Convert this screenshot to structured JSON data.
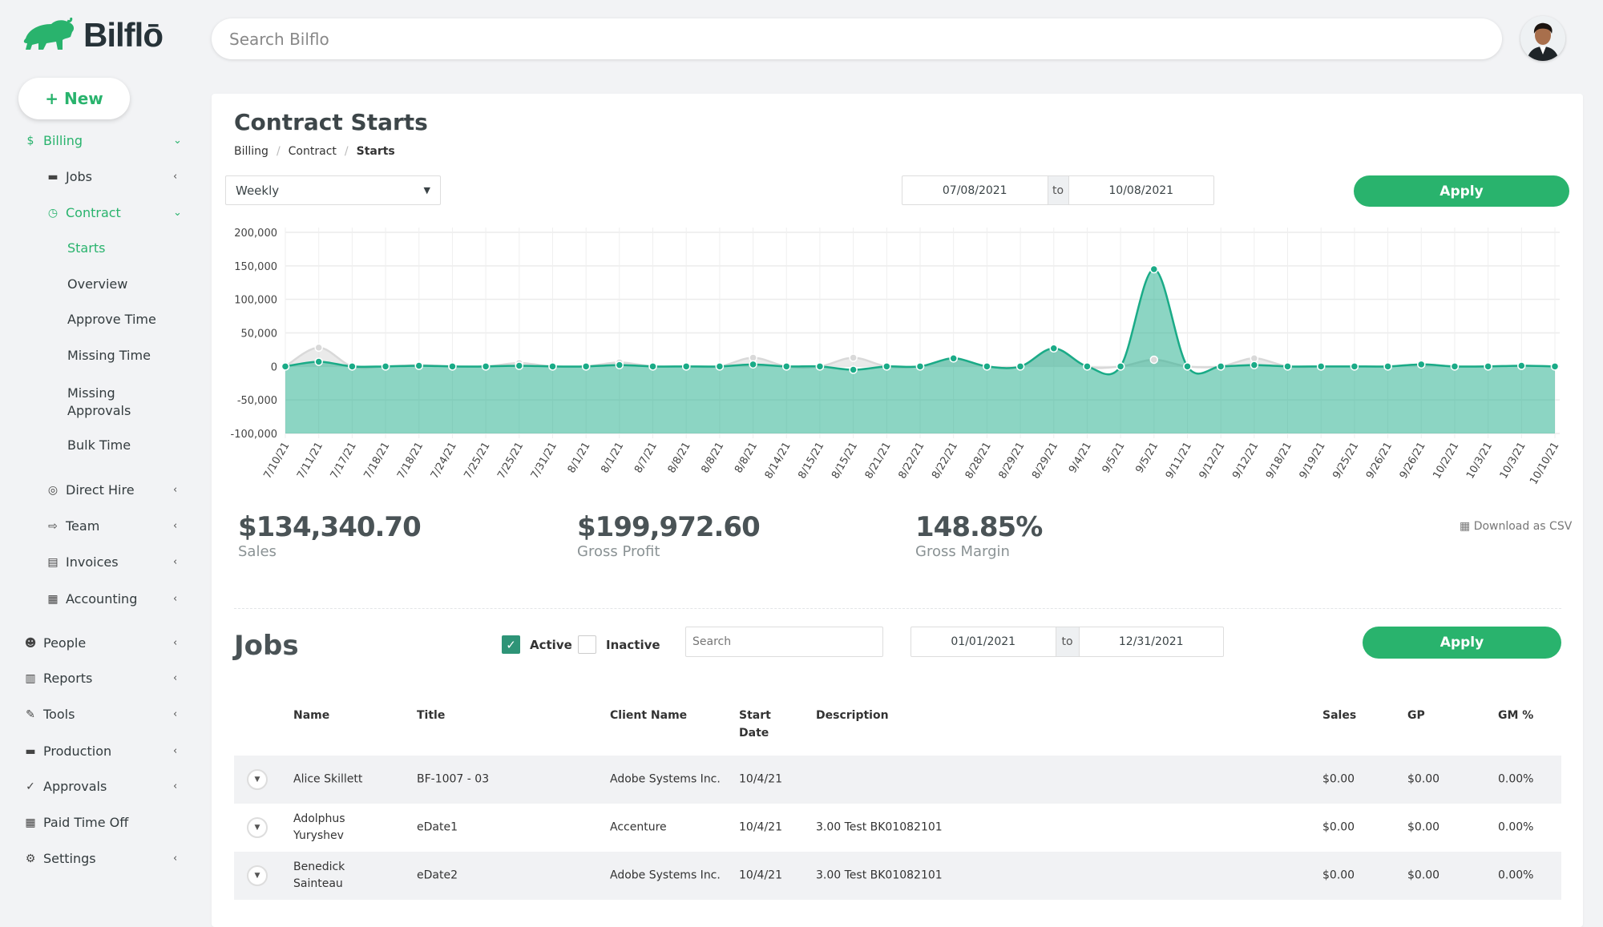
{
  "brand": {
    "name": "Bilflō",
    "color": "#29b36d"
  },
  "search": {
    "placeholder": "Search Bilflo"
  },
  "new_button": "+ New",
  "sidebar": {
    "items": [
      {
        "label": "Billing",
        "icon": "dollar-icon",
        "glyph": "$",
        "level": 0,
        "active": true,
        "chevron": "down"
      },
      {
        "label": "Jobs",
        "icon": "briefcase-icon",
        "glyph": "▬",
        "level": 1,
        "chevron": "left"
      },
      {
        "label": "Contract",
        "icon": "clock-icon",
        "glyph": "◷",
        "level": 1,
        "active": true,
        "chevron": "down"
      },
      {
        "label": "Starts",
        "level": 2,
        "active": true
      },
      {
        "label": "Overview",
        "level": 2
      },
      {
        "label": "Approve Time",
        "level": 2
      },
      {
        "label": "Missing Time",
        "level": 2
      },
      {
        "label": "Missing Approvals",
        "level": 2
      },
      {
        "label": "Bulk Time",
        "level": 2
      },
      {
        "label": "Direct Hire",
        "icon": "target-icon",
        "glyph": "◎",
        "level": 1,
        "chevron": "left"
      },
      {
        "label": "Team",
        "icon": "sign-in-icon",
        "glyph": "⇨",
        "level": 1,
        "chevron": "left"
      },
      {
        "label": "Invoices",
        "icon": "document-icon",
        "glyph": "▤",
        "level": 1,
        "chevron": "left"
      },
      {
        "label": "Accounting",
        "icon": "calculator-icon",
        "glyph": "▦",
        "level": 1,
        "chevron": "left"
      },
      {
        "label": "People",
        "icon": "users-icon",
        "glyph": "☻",
        "level": 0,
        "chevron": "left"
      },
      {
        "label": "Reports",
        "icon": "bar-chart-icon",
        "glyph": "▥",
        "level": 0,
        "chevron": "left"
      },
      {
        "label": "Tools",
        "icon": "wrench-icon",
        "glyph": "✎",
        "level": 0,
        "chevron": "left"
      },
      {
        "label": "Production",
        "icon": "briefcase-icon",
        "glyph": "▬",
        "level": 0,
        "chevron": "left"
      },
      {
        "label": "Approvals",
        "icon": "thumbs-up-icon",
        "glyph": "✓",
        "level": 0,
        "chevron": "left"
      },
      {
        "label": "Paid Time Off",
        "icon": "calendar-icon",
        "glyph": "▦",
        "level": 0
      },
      {
        "label": "Settings",
        "icon": "gear-icon",
        "glyph": "⚙",
        "level": 0,
        "chevron": "left"
      }
    ]
  },
  "page": {
    "title": "Contract Starts",
    "breadcrumb": [
      "Billing",
      "Contract",
      "Starts"
    ]
  },
  "filters": {
    "period": "Weekly",
    "from": "07/08/2021",
    "to_label": "to",
    "to": "10/08/2021",
    "apply": "Apply"
  },
  "chart_data": {
    "type": "area",
    "ylim": [
      -100000,
      200000
    ],
    "yticks": [
      "200,000",
      "150,000",
      "100,000",
      "50,000",
      "0",
      "-50,000",
      "-100,000"
    ],
    "ytick_values": [
      200000,
      150000,
      100000,
      50000,
      0,
      -50000,
      -100000
    ],
    "grid": true,
    "categories": [
      "7/10/21",
      "7/11/21",
      "7/17/21",
      "7/18/21",
      "7/18/21",
      "7/24/21",
      "7/25/21",
      "7/25/21",
      "7/31/21",
      "8/1/21",
      "8/1/21",
      "8/7/21",
      "8/8/21",
      "8/8/21",
      "8/8/21",
      "8/14/21",
      "8/15/21",
      "8/15/21",
      "8/21/21",
      "8/22/21",
      "8/22/21",
      "8/28/21",
      "8/29/21",
      "8/29/21",
      "9/4/21",
      "9/5/21",
      "9/5/21",
      "9/11/21",
      "9/12/21",
      "9/12/21",
      "9/18/21",
      "9/19/21",
      "9/25/21",
      "9/26/21",
      "9/26/21",
      "10/2/21",
      "10/3/21",
      "10/3/21",
      "10/10/21"
    ],
    "series": [
      {
        "color": "#d9d9d9",
        "values": [
          0,
          28000,
          0,
          0,
          2000,
          0,
          0,
          5000,
          0,
          0,
          6000,
          0,
          0,
          0,
          13000,
          0,
          0,
          13000,
          0,
          0,
          12000,
          0,
          0,
          27000,
          0,
          0,
          10000,
          0,
          0,
          12000,
          0,
          0,
          0,
          0,
          3000,
          0,
          0,
          1000,
          0
        ]
      },
      {
        "color": "#1aab87",
        "values": [
          0,
          7000,
          0,
          0,
          1000,
          0,
          0,
          1000,
          0,
          0,
          2000,
          0,
          0,
          0,
          3000,
          0,
          0,
          -5000,
          0,
          0,
          12000,
          0,
          0,
          27000,
          0,
          0,
          145000,
          0,
          0,
          2000,
          0,
          0,
          0,
          0,
          3000,
          0,
          0,
          1000,
          0
        ]
      }
    ]
  },
  "stats": [
    {
      "value": "$134,340.70",
      "label": "Sales"
    },
    {
      "value": "$199,972.60",
      "label": "Gross Profit"
    },
    {
      "value": "148.85%",
      "label": "Gross Margin"
    }
  ],
  "download_csv": "Download as CSV",
  "jobs": {
    "heading": "Jobs",
    "active_label": "Active",
    "active_checked": true,
    "inactive_label": "Inactive",
    "inactive_checked": false,
    "search_placeholder": "Search",
    "from": "01/01/2021",
    "to_label": "to",
    "to": "12/31/2021",
    "apply": "Apply",
    "columns": [
      "Name",
      "Title",
      "Client Name",
      "Start Date",
      "Description",
      "Sales",
      "GP",
      "GM %"
    ],
    "rows": [
      [
        "Alice Skillett",
        "BF-1007 - 03",
        "Adobe Systems Inc.",
        "10/4/21",
        "",
        "$0.00",
        "$0.00",
        "0.00%"
      ],
      [
        "Adolphus Yuryshev",
        "eDate1",
        "Accenture",
        "10/4/21",
        "3.00 Test BK01082101",
        "$0.00",
        "$0.00",
        "0.00%"
      ],
      [
        "Benedick Sainteau",
        "eDate2",
        "Adobe Systems Inc.",
        "10/4/21",
        "3.00 Test BK01082101",
        "$0.00",
        "$0.00",
        "0.00%"
      ]
    ]
  }
}
